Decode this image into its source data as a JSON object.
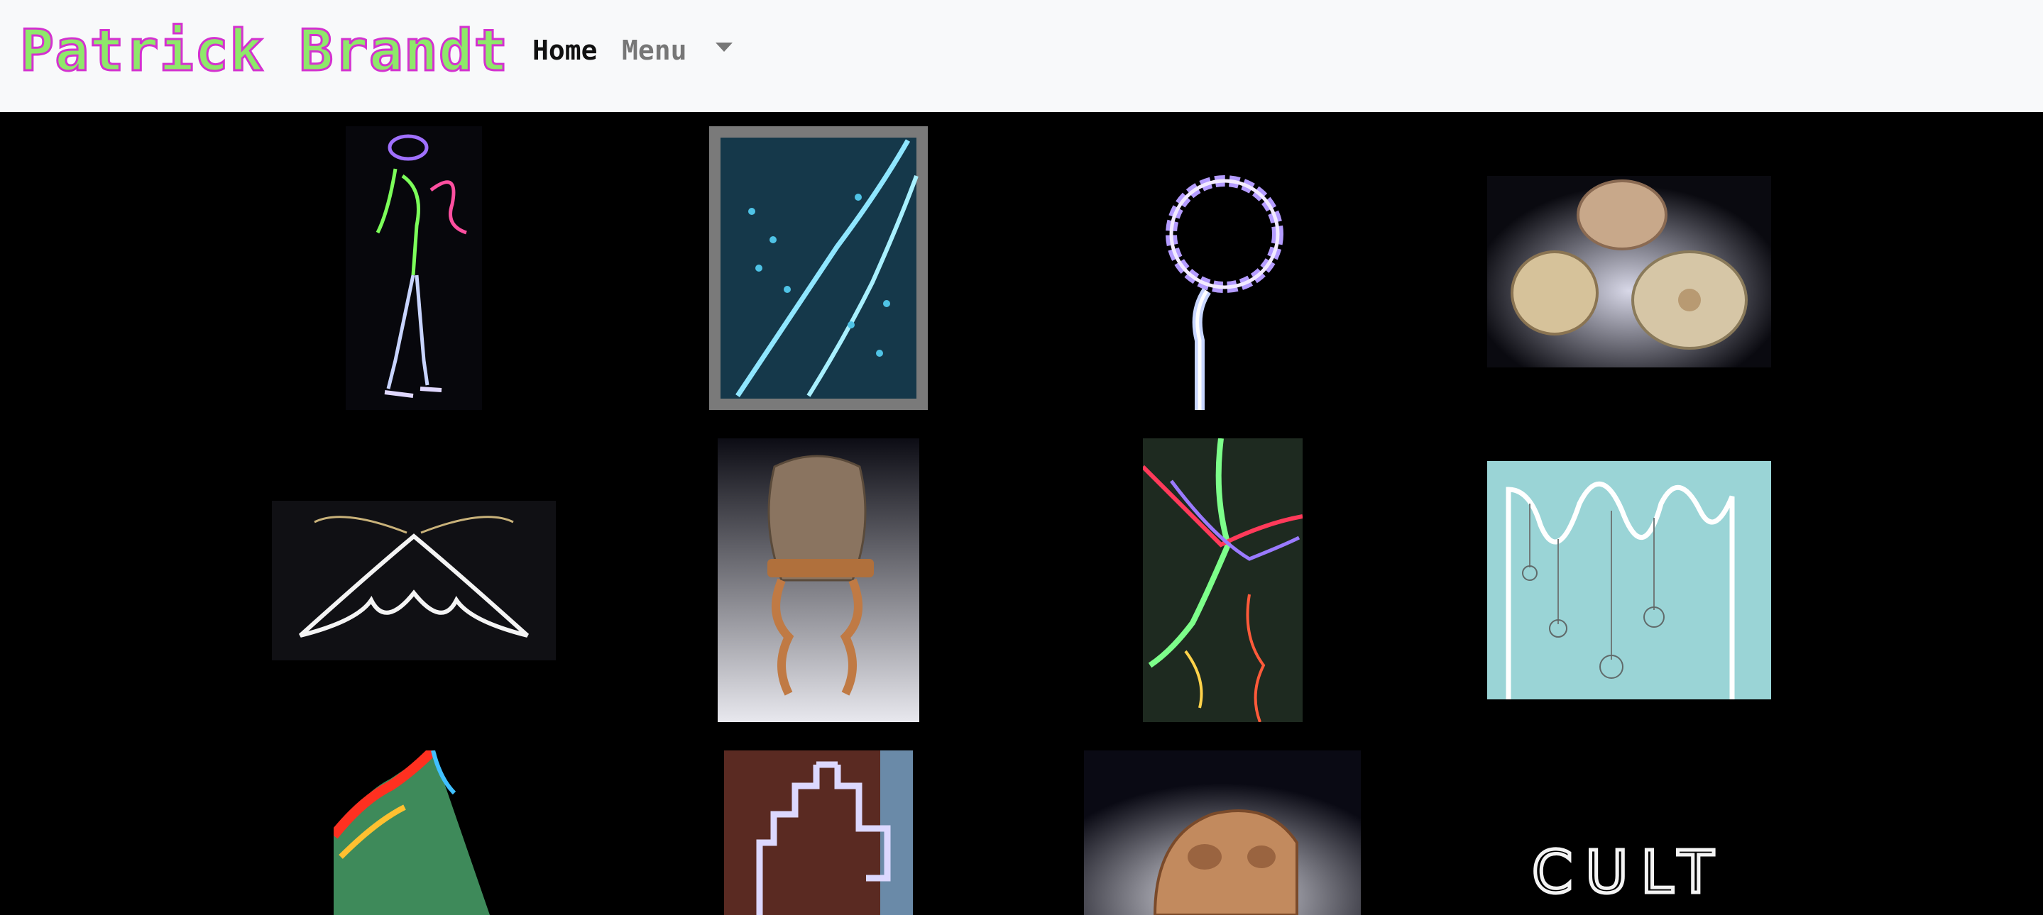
{
  "navbar": {
    "brand": "Patrick Brandt",
    "home_label": "Home",
    "menu_label": "Menu",
    "menu_icon": "caret-down-icon"
  },
  "colors": {
    "navbar_bg": "#f8f9fa",
    "page_bg": "#000000",
    "brand_fill": "#8ee86a",
    "brand_outline": "#d431d0",
    "home_text": "#111111",
    "menu_text": "#777777"
  },
  "gallery": {
    "columns": 4,
    "visible_rows": 3,
    "artwork_sign_text": "CULT"
  }
}
